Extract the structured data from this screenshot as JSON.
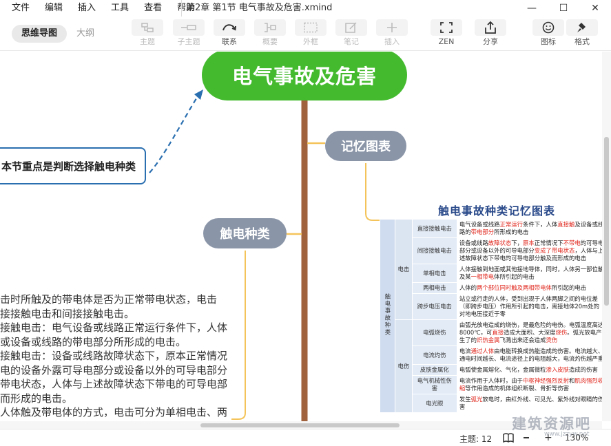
{
  "menu": [
    "文件",
    "编辑",
    "插入",
    "工具",
    "查看",
    "帮助"
  ],
  "window_title": "第2章 第1节 电气事故及危害.xmind",
  "window_controls": {
    "minimize": "—",
    "maximize": "☐",
    "close": "✕"
  },
  "mode_tabs": {
    "mindmap": "思维导图",
    "outline": "大纲"
  },
  "toolbar": {
    "topic": "主题",
    "subtopic": "子主题",
    "relationship": "联系",
    "summary": "概要",
    "boundary": "外框",
    "note": "笔记",
    "insert": "插入",
    "zen": "ZEN",
    "share": "分享",
    "icon": "图标",
    "format": "格式"
  },
  "map": {
    "central": "电气事故及危害",
    "topic_memory": "记忆图表",
    "topic_shock": "触电种类",
    "floating": "本节重点是判断选择触电种类",
    "note_lines": [
      "击时所触及的带电体是否为正常带电状态，电击",
      "接接触电击和间接接触电击。",
      "接触电击：电气设备或线路正常运行条件下，人体",
      "或设备或线路的带电部分所形成的电击。",
      "接触电击：设备或线路故障状态下，原本正常情况",
      "电的设备外露可导电部分或设备以外的可导电部分",
      "带电状态，人体与上述故障状态下带电的可导电部",
      "而形成的电击。",
      "人体触及带电体的方式，电击可分为单相电击、两"
    ]
  },
  "image_table": {
    "title": "触电事故种类记忆图表",
    "root_label": "触电事故种类",
    "group_shock": "电击",
    "group_burn": "电伤",
    "rows": [
      {
        "name": "直接接触电击",
        "parts": [
          [
            "电气设备或线路",
            ""
          ],
          [
            "正常运行",
            "red"
          ],
          [
            "条件下，人体",
            ""
          ],
          [
            "直接触",
            "red"
          ],
          [
            "及设备或线路的",
            ""
          ],
          [
            "带电部分",
            "red"
          ],
          [
            "所形成的电击",
            ""
          ]
        ]
      },
      {
        "name": "间接接触电击",
        "parts": [
          [
            "设备或线路",
            ""
          ],
          [
            "故障状态",
            "red"
          ],
          [
            "下，",
            ""
          ],
          [
            "原本",
            "red"
          ],
          [
            "正常情况下",
            ""
          ],
          [
            "不带电",
            "red"
          ],
          [
            "的可导电部分或设备以外的可导电部分",
            ""
          ],
          [
            "变成了带电状态",
            "red"
          ],
          [
            "，人体与上述故障状态下带电的可导电部分触及而形成的电击",
            ""
          ]
        ]
      },
      {
        "name": "单相电击",
        "parts": [
          [
            "人体接触到地面或其他接地导体，同时，人体另一部位触及某",
            ""
          ],
          [
            "一相带电",
            "red"
          ],
          [
            "体所引起的电击",
            ""
          ]
        ]
      },
      {
        "name": "两相电击",
        "parts": [
          [
            "人体的",
            ""
          ],
          [
            "两个部位同时触及两相带电体",
            "red"
          ],
          [
            "所引起的电击",
            ""
          ]
        ]
      },
      {
        "name": "跨步电压电击",
        "parts": [
          [
            "站立或行走的人体，受到出现于人体两脚之间的电位差（即跨步电压）作用所引起的电击，离接地体20m处的对地电压接近于零",
            ""
          ]
        ]
      },
      {
        "name": "电弧烧伤",
        "parts": [
          [
            "由弧光放电造成的烧伤，是最危险的电伤。电弧温度高达8000℃，可",
            ""
          ],
          [
            "直接",
            "red"
          ],
          [
            "造成大面积、大深度",
            ""
          ],
          [
            "烧伤",
            "red"
          ],
          [
            "。弧光放电产生了的",
            ""
          ],
          [
            "炽热金属",
            "red"
          ],
          [
            "飞溅出来还会造成",
            ""
          ],
          [
            "烫伤",
            "red"
          ]
        ]
      },
      {
        "name": "电流灼伤",
        "parts": [
          [
            "电流",
            ""
          ],
          [
            "通过人体",
            "red"
          ],
          [
            "由电能转换成热能造成的伤害。电流越大、通电时间越长、电流途径上的电阻越大，电流灼伤越严重",
            ""
          ]
        ]
      },
      {
        "name": "皮肤金属化",
        "parts": [
          [
            "电弧使金属熔化、气化，金属微粒",
            ""
          ],
          [
            "渗入皮肤",
            "red"
          ],
          [
            "造成的伤害",
            ""
          ]
        ]
      },
      {
        "name": "电气机械性伤害",
        "parts": [
          [
            "电流作用于人体时，由于",
            ""
          ],
          [
            "中枢神经强烈反射",
            "red"
          ],
          [
            "和",
            ""
          ],
          [
            "肌肉强烈收缩",
            "red"
          ],
          [
            "等作用造成的机体组织断裂、骨折等伤害",
            ""
          ]
        ]
      },
      {
        "name": "电光眼",
        "parts": [
          [
            "发生",
            ""
          ],
          [
            "弧光",
            "red"
          ],
          [
            "放电时，由红外线、可见光、紫外线对眼睛的伤害",
            ""
          ]
        ]
      }
    ]
  },
  "status": {
    "topic_count": "主题: 12",
    "zoom": "130%"
  },
  "watermark": {
    "main": "建筑资源吧",
    "sub": "www.jzzyw.net"
  },
  "colors": {
    "central": "#44bb2f",
    "topic": "#8a95a8",
    "trunk": "#a0623c",
    "branch": "#f4c45a",
    "floating_border": "#2a6fb0"
  }
}
